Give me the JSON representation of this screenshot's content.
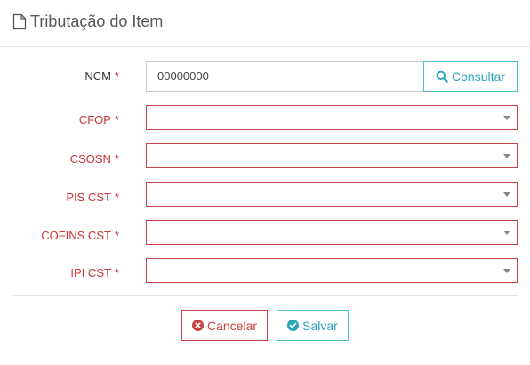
{
  "window": {
    "title": "Tributação do Item",
    "title_icon": "file-icon"
  },
  "form": {
    "required_marker": "*",
    "ncm": {
      "label": "NCM",
      "value": "00000000",
      "consult_label": "Consultar",
      "consult_icon": "search-icon"
    },
    "fields": [
      {
        "label": "CFOP",
        "value": ""
      },
      {
        "label": "CSOSN",
        "value": ""
      },
      {
        "label": "PIS CST",
        "value": ""
      },
      {
        "label": "COFINS CST",
        "value": ""
      },
      {
        "label": "IPI CST",
        "value": ""
      }
    ]
  },
  "actions": {
    "cancel_label": "Cancelar",
    "cancel_icon": "times-circle-icon",
    "save_label": "Salvar",
    "save_icon": "check-circle-icon"
  },
  "colors": {
    "error": "#c84343",
    "accent": "#2aa6bd",
    "border": "#cccccc"
  }
}
